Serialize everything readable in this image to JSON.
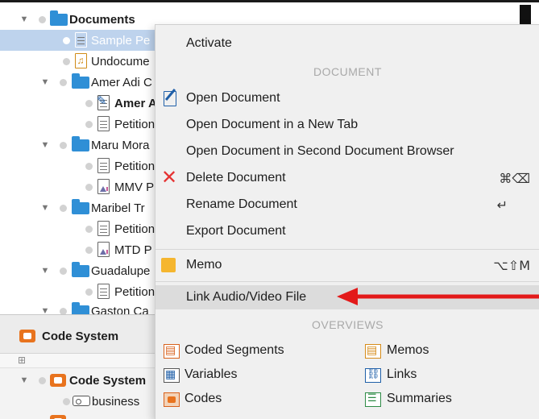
{
  "tree": {
    "root": "Documents",
    "items": [
      {
        "label": "Sample Pe",
        "icon": "document-icon"
      },
      {
        "label": "Undocume",
        "icon": "audio-document-icon"
      },
      {
        "label": "Amer Adi C",
        "icon": "folder-icon"
      },
      {
        "label": "Amer A",
        "icon": "edit-document-icon"
      },
      {
        "label": "Petition",
        "icon": "document-icon"
      },
      {
        "label": "Maru Mora",
        "icon": "folder-icon"
      },
      {
        "label": "Petition",
        "icon": "document-icon"
      },
      {
        "label": "MMV P",
        "icon": "image-document-icon"
      },
      {
        "label": "Maribel Tr",
        "icon": "folder-icon"
      },
      {
        "label": "Petition",
        "icon": "document-icon"
      },
      {
        "label": "MTD P",
        "icon": "image-document-icon"
      },
      {
        "label": "Guadalupe",
        "icon": "folder-icon"
      },
      {
        "label": "Petition",
        "icon": "document-icon"
      },
      {
        "label": "Gaston Ca",
        "icon": "folder-icon"
      }
    ]
  },
  "code_system": {
    "header": "Code System",
    "root": "Code System",
    "child": "business"
  },
  "menu": {
    "activate": "Activate",
    "section_document": "DOCUMENT",
    "open_document": "Open Document",
    "open_new_tab": "Open Document in a New Tab",
    "open_second_browser": "Open Document in Second Document Browser",
    "delete_document": "Delete Document",
    "delete_shortcut": "⌘⌫",
    "rename_document": "Rename Document",
    "rename_shortcut": "↵",
    "export_document": "Export Document",
    "memo": "Memo",
    "memo_shortcut": "⌥⇧M",
    "link_av": "Link Audio/Video File",
    "section_overviews": "OVERVIEWS",
    "coded_segments": "Coded Segments",
    "memos": "Memos",
    "variables": "Variables",
    "links": "Links",
    "codes": "Codes",
    "summaries": "Summaries"
  },
  "colors": {
    "selection": "#bed3ed",
    "folder": "#2f8fd6",
    "delete": "#e53232",
    "memo": "#f5b62f",
    "arrow": "#e31919"
  }
}
